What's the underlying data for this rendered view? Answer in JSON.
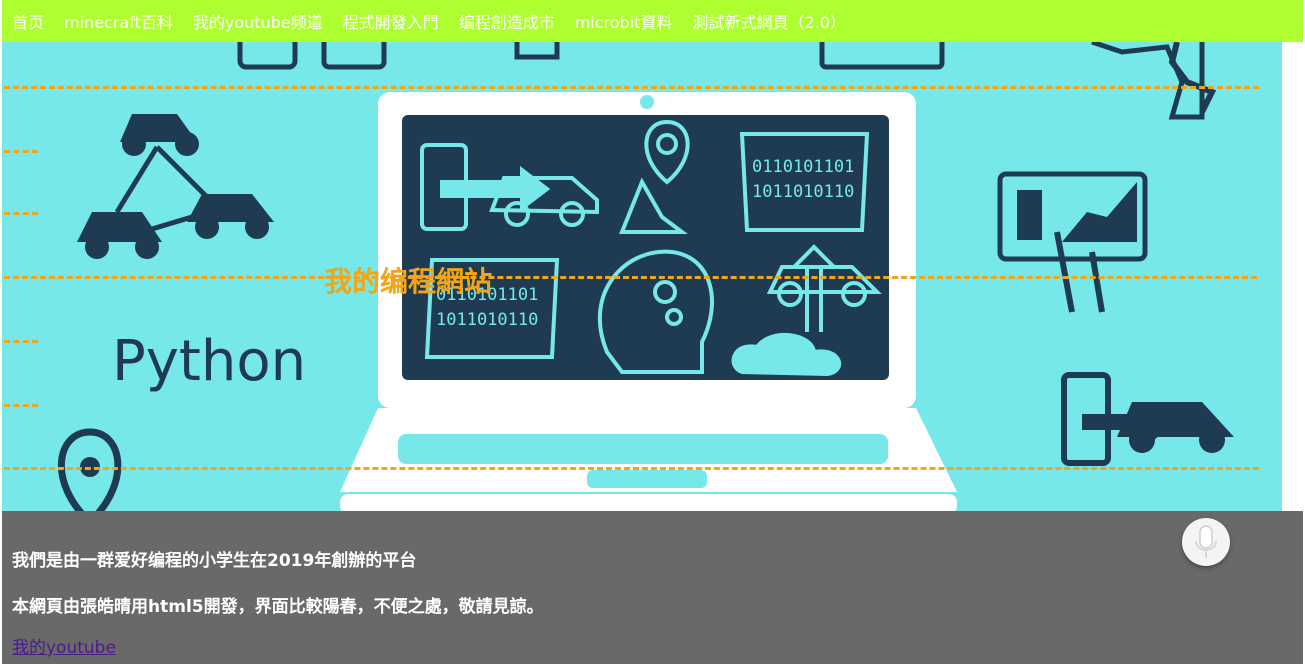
{
  "nav": {
    "items": [
      {
        "label": "首页"
      },
      {
        "label": "minecraft百科"
      },
      {
        "label": "我的youtube频道"
      },
      {
        "label": "程式開發入門"
      },
      {
        "label": "编程創造成市"
      },
      {
        "label": "microbit資料"
      },
      {
        "label": "測試新式網頁（2.0）"
      }
    ]
  },
  "hero": {
    "title": "我的编程網站",
    "image_text": {
      "python": "Python",
      "binary_top_1": "0110101101",
      "binary_top_2": "1011010110",
      "binary_bottom_1": "0110101101",
      "binary_bottom_2": "1011010110"
    }
  },
  "footer": {
    "line1": "我們是由一群爱好编程的小学生在2019年創辦的平台",
    "line2": "本網頁由張皓晴用html5開發，界面比較陽春，不便之處，敬請見諒。",
    "link": "我的youtube"
  },
  "colors": {
    "nav_bg": "#adff2f",
    "hero_bg": "#76e8ea",
    "accent_orange": "#f4a417",
    "footer_bg": "#696969",
    "dark_navy": "#1e3b52"
  },
  "icons": [
    "microphone-icon"
  ]
}
